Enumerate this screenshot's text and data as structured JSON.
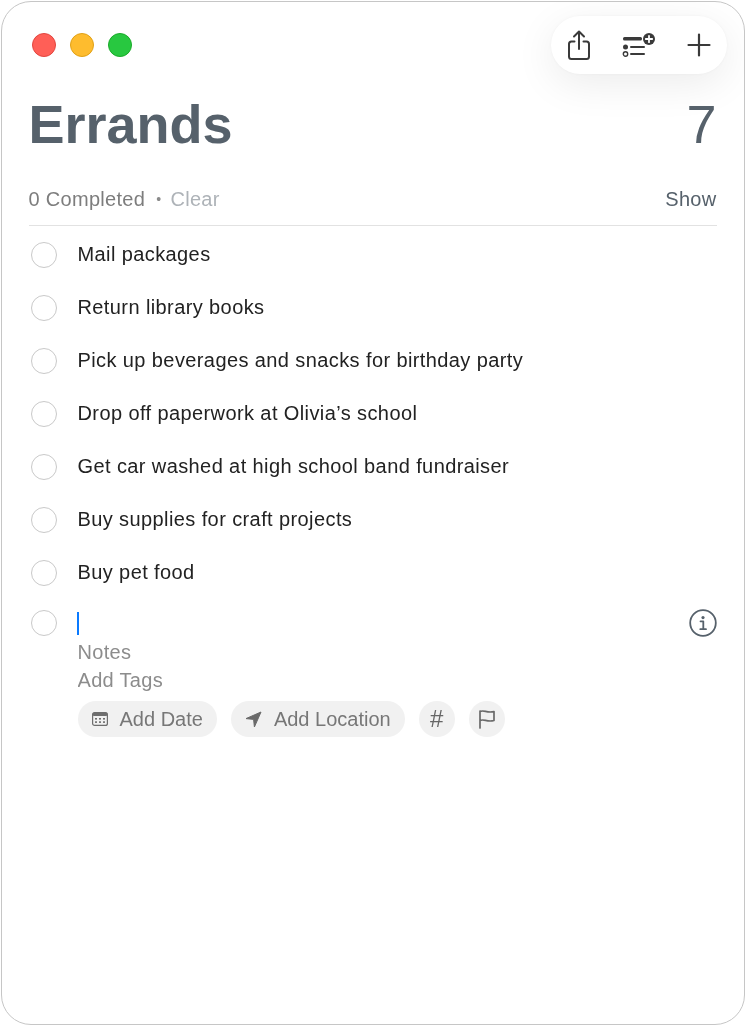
{
  "list": {
    "title": "Errands",
    "count": "7"
  },
  "completed_bar": {
    "completed": "0 Completed",
    "separator": "•",
    "clear": "Clear",
    "show": "Show"
  },
  "items": [
    {
      "title": "Mail packages",
      "checked": false
    },
    {
      "title": "Return library books",
      "checked": false
    },
    {
      "title": "Pick up beverages and snacks for birthday party",
      "checked": false
    },
    {
      "title": "Drop off paperwork at Olivia’s school",
      "checked": false
    },
    {
      "title": "Get car washed at high school band fundraiser",
      "checked": false
    },
    {
      "title": "Buy supplies for craft projects",
      "checked": false
    },
    {
      "title": "Buy pet food",
      "checked": false
    }
  ],
  "new_item": {
    "checked": false,
    "focused": true,
    "notes": {
      "placeholder": "Notes"
    },
    "tags": {
      "placeholder": "Add Tags"
    },
    "chips": [
      {
        "kind": "date",
        "label": "Add Date"
      },
      {
        "kind": "location",
        "label": "Add Location"
      },
      {
        "kind": "tag",
        "label": "#"
      },
      {
        "kind": "flag"
      }
    ]
  }
}
